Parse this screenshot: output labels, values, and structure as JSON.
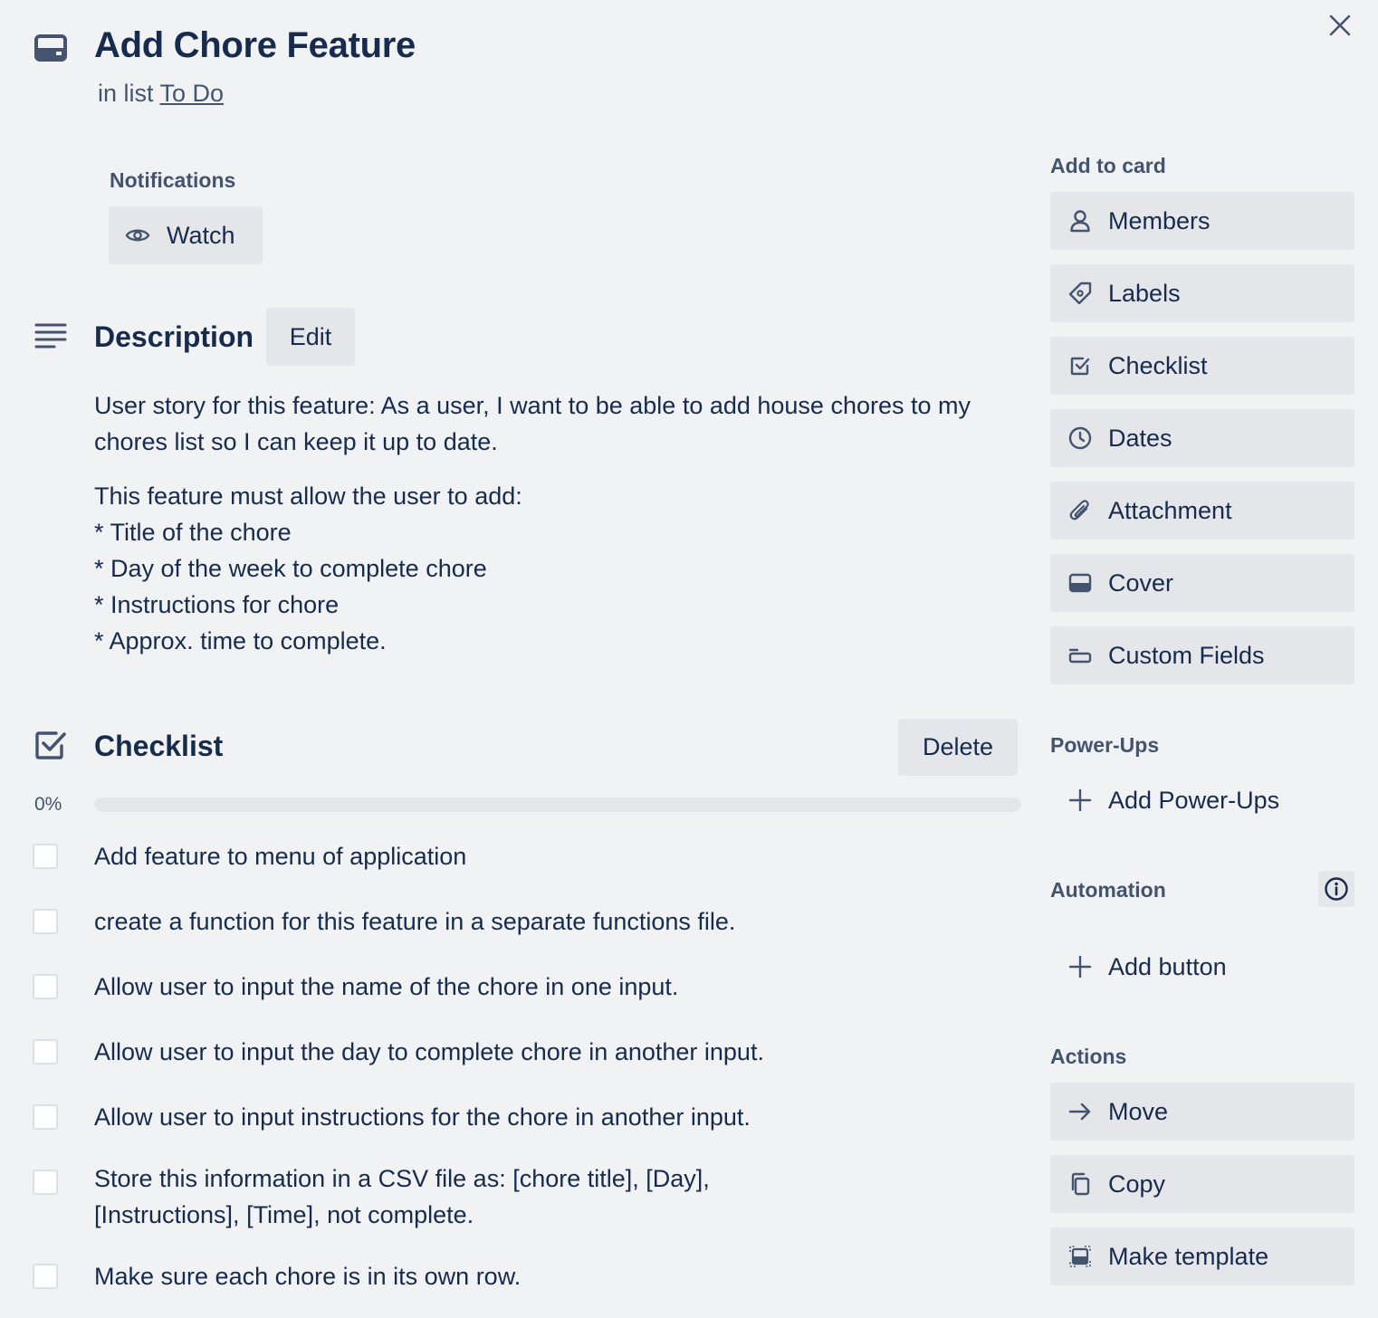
{
  "card": {
    "title": "Add Chore Feature",
    "in_list_prefix": "in list",
    "list_name": "To Do"
  },
  "notifications": {
    "label": "Notifications",
    "watch_label": "Watch"
  },
  "description": {
    "title": "Description",
    "edit_label": "Edit",
    "paragraph1": "User story for this feature: As a user, I want to be able to add house chores to my chores list so I can keep it up to date.",
    "intro": "This feature must allow the user to add:",
    "bullets": [
      "* Title of the chore",
      "* Day of the week to complete chore",
      "* Instructions for chore",
      "* Approx. time to complete."
    ]
  },
  "checklist": {
    "title": "Checklist",
    "delete_label": "Delete",
    "percent_label": "0%",
    "progress_fraction": 0,
    "items": [
      "Add feature to menu of application",
      "create a function for this feature in a separate functions file.",
      "Allow user to input the name of the chore in one input.",
      "Allow user to input the day to complete chore in another input.",
      "Allow user to input instructions for the chore in another input.",
      "Store this information in a CSV file as: [chore title], [Day], [Instructions], [Time], not complete.",
      "Make sure each chore is in its own row."
    ]
  },
  "sidebar": {
    "add_to_card_label": "Add to card",
    "add_to_card": [
      {
        "label": "Members",
        "icon": "person-icon"
      },
      {
        "label": "Labels",
        "icon": "tag-icon"
      },
      {
        "label": "Checklist",
        "icon": "checkbox-icon"
      },
      {
        "label": "Dates",
        "icon": "clock-icon"
      },
      {
        "label": "Attachment",
        "icon": "paperclip-icon"
      },
      {
        "label": "Cover",
        "icon": "cover-icon"
      },
      {
        "label": "Custom Fields",
        "icon": "custom-fields-icon"
      }
    ],
    "powerups_label": "Power-Ups",
    "add_powerups_label": "Add Power-Ups",
    "automation_label": "Automation",
    "add_button_label": "Add button",
    "actions_label": "Actions",
    "actions": [
      {
        "label": "Move",
        "icon": "arrow-right-icon"
      },
      {
        "label": "Copy",
        "icon": "copy-icon"
      },
      {
        "label": "Make template",
        "icon": "template-icon"
      }
    ]
  },
  "colors": {
    "background": "#f1f2f4",
    "button": "#e4e6ea",
    "text": "#172b4d",
    "subtle_text": "#44546f"
  }
}
